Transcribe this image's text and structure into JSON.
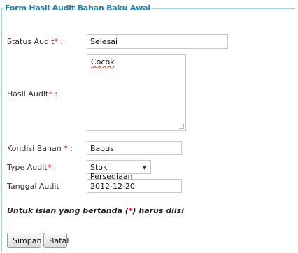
{
  "form": {
    "legend": "Form Hasil Audit Bahan Baku Awal",
    "status": {
      "label": "Status Audit",
      "colon": " :",
      "value": "Selesai"
    },
    "hasil": {
      "label": "Hasil Audit",
      "colon": " :",
      "value": "Cocok"
    },
    "kondisi": {
      "label": "Kondisi Bahan ",
      "colon": " :",
      "value": "Bagus"
    },
    "type": {
      "label": "Type Audit",
      "colon": " :",
      "value": "Stok Persediaan"
    },
    "tanggal": {
      "label": "Tanggal Audit",
      "value": "2012-12-20"
    },
    "required_mark": "*",
    "note_prefix": "Untuk isian yang bertanda (",
    "note_mark": "*",
    "note_suffix": ") harus diisi"
  },
  "buttons": {
    "save": "Simpan",
    "cancel": "Batal"
  },
  "colors": {
    "accent": "#1f7fb3",
    "required": "#e02020",
    "border": "#a9d0dc"
  }
}
